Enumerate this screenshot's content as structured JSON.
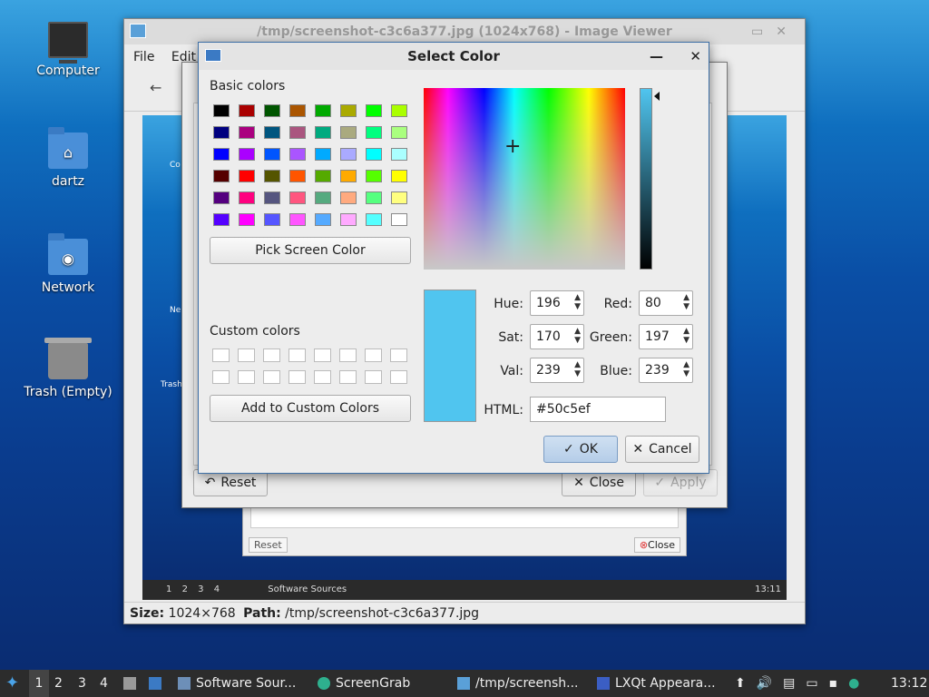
{
  "desktop": {
    "icons": [
      {
        "label": "Computer",
        "icon": "computer-icon"
      },
      {
        "label": "dartz",
        "icon": "home-folder-icon"
      },
      {
        "label": "Network",
        "icon": "network-folder-icon"
      },
      {
        "label": "Trash (Empty)",
        "icon": "trash-icon"
      }
    ]
  },
  "image_viewer": {
    "title": "/tmp/screenshot-c3c6a377.jpg (1024x768) - Image Viewer",
    "menu": [
      "File",
      "Edit"
    ],
    "status": {
      "size_label": "Size:",
      "size_value": "1024×768",
      "path_label": "Path:",
      "path_value": "/tmp/screenshot-c3c6a377.jpg"
    },
    "inner": {
      "reset": "Reset",
      "close": "Close",
      "taskbar_workspaces": [
        "1",
        "2",
        "3",
        "4"
      ],
      "taskbar_task": "Software Sources",
      "clock": "13:11",
      "desk_labels": [
        "Co",
        "Ne",
        "Trash"
      ]
    }
  },
  "appearance_window": {
    "reset": "Reset",
    "close": "Close",
    "apply": "Apply"
  },
  "color_dialog": {
    "title": "Select Color",
    "basic_colors_label": "Basic colors",
    "basic_colors": [
      [
        "#000000",
        "#aa0000",
        "#005500",
        "#aa5500",
        "#00aa00",
        "#aaaa00",
        "#00ff00",
        "#aaff00"
      ],
      [
        "#00007f",
        "#aa007f",
        "#00557f",
        "#aa557f",
        "#00aa7f",
        "#aaaa7f",
        "#00ff7f",
        "#aaff7f"
      ],
      [
        "#0000ff",
        "#aa00ff",
        "#0055ff",
        "#aa55ff",
        "#00aaff",
        "#aaaaff",
        "#00ffff",
        "#aaffff"
      ],
      [
        "#550000",
        "#ff0000",
        "#555500",
        "#ff5500",
        "#55aa00",
        "#ffaa00",
        "#55ff00",
        "#ffff00"
      ],
      [
        "#55007f",
        "#ff007f",
        "#55557f",
        "#ff557f",
        "#55aa7f",
        "#ffaa7f",
        "#55ff7f",
        "#ffff7f"
      ],
      [
        "#5500ff",
        "#ff00ff",
        "#5555ff",
        "#ff55ff",
        "#55aaff",
        "#ffaaff",
        "#55ffff",
        "#ffffff"
      ]
    ],
    "pick_screen_color": "Pick Screen Color",
    "custom_colors_label": "Custom colors",
    "add_custom": "Add to Custom Colors",
    "fields": {
      "hue_label": "Hue:",
      "hue": "196",
      "sat_label": "Sat:",
      "sat": "170",
      "val_label": "Val:",
      "val": "239",
      "red_label": "Red:",
      "red": "80",
      "green_label": "Green:",
      "green": "197",
      "blue_label": "Blue:",
      "blue": "239",
      "html_label": "HTML:",
      "html": "#50c5ef"
    },
    "ok": "OK",
    "cancel": "Cancel",
    "current_color": "#50c5ef"
  },
  "taskbar": {
    "workspaces": [
      "1",
      "2",
      "3",
      "4"
    ],
    "tasks": [
      "Software Sour...",
      "ScreenGrab",
      "/tmp/screensh...",
      "LXQt Appeara..."
    ],
    "clock": "13:12"
  }
}
